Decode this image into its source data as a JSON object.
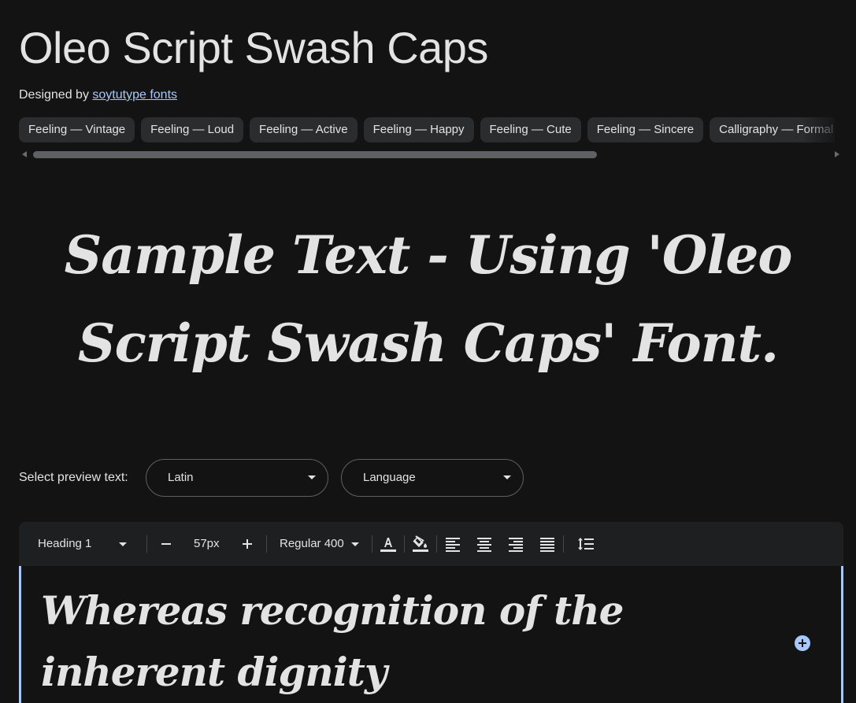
{
  "font": {
    "name": "Oleo Script Swash Caps",
    "designed_by_label": "Designed by",
    "designer": "soytutype fonts"
  },
  "tags": [
    "Feeling — Vintage",
    "Feeling — Loud",
    "Feeling — Active",
    "Feeling — Happy",
    "Feeling — Cute",
    "Feeling — Sincere",
    "Calligraphy — Formal"
  ],
  "sample_text": "Sample Text - Using 'Oleo Script Swash Caps' Font.",
  "preview": {
    "label": "Select preview text:",
    "script_value": "Latin",
    "language_value": "Language"
  },
  "toolbar": {
    "style_value": "Heading 1",
    "size_value": "57px",
    "weight_value": "Regular 400"
  },
  "editor_text": "Whereas recognition of the inherent dignity",
  "icons": {
    "minus": "minus-icon",
    "plus": "plus-icon",
    "text_color": "text-color-icon",
    "fill_color": "fill-color-icon",
    "align_left": "align-left-icon",
    "align_center": "align-center-icon",
    "align_right": "align-right-icon",
    "align_justify": "align-justify-icon",
    "line_height": "line-height-icon",
    "add": "add-circle-icon"
  },
  "colors": {
    "background": "#131314",
    "text": "#e3e3e3",
    "link": "#a8c7fa",
    "chip": "#2b2c2e",
    "toolbar": "#1e1f20",
    "accent": "#a8c7fa"
  }
}
